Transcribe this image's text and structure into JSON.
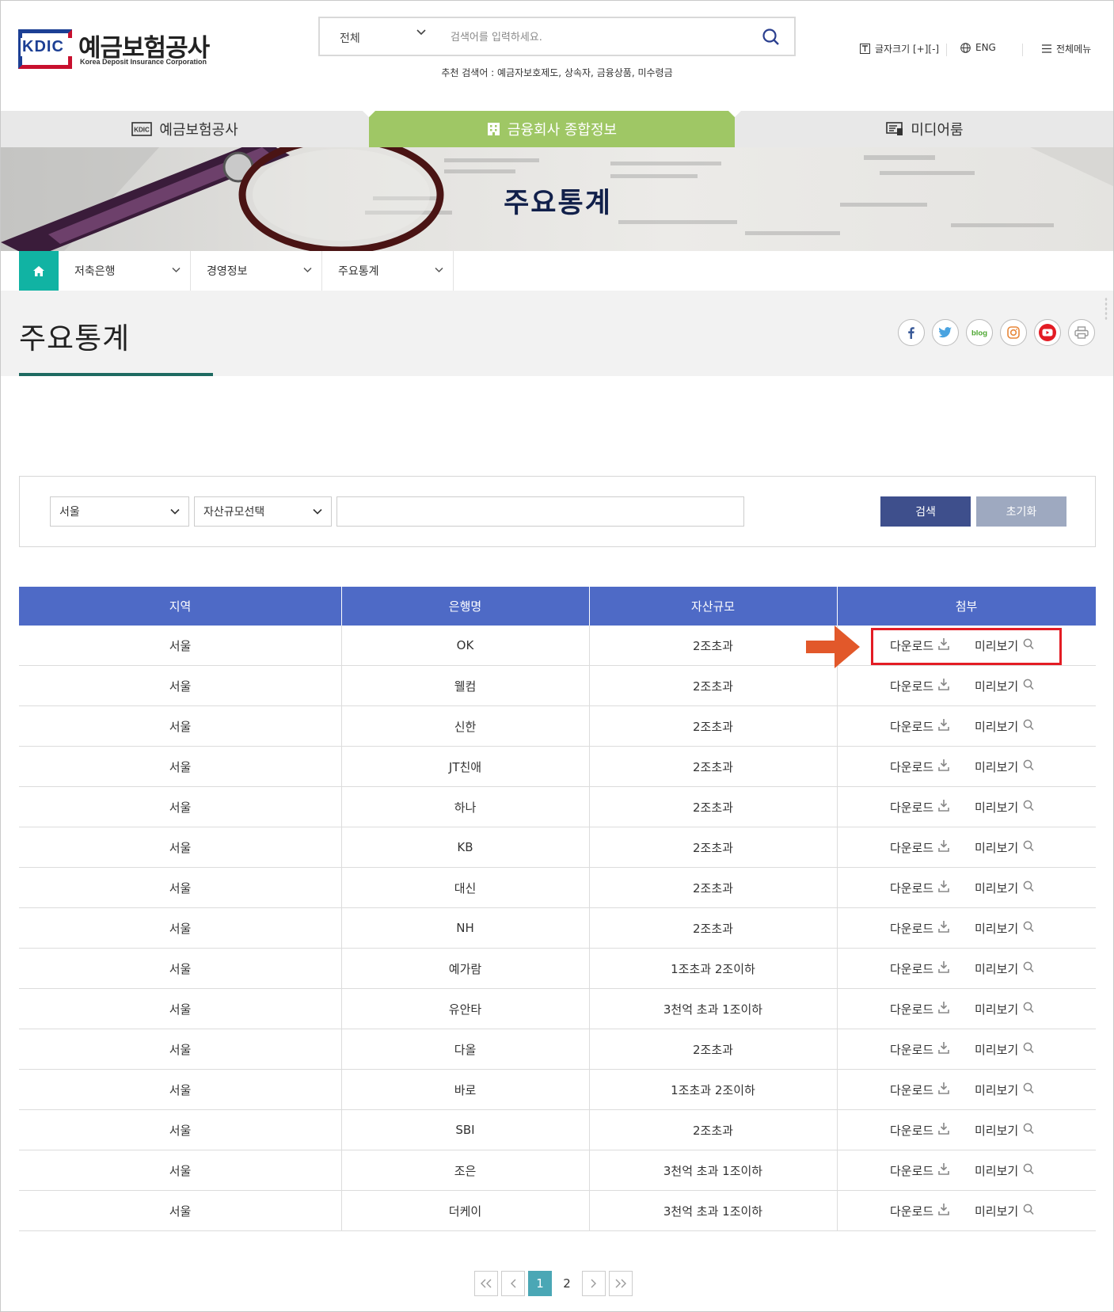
{
  "header": {
    "logo_abbr": "KDIC",
    "logo_name": "예금보험공사",
    "logo_sub": "Korea Deposit Insurance Corporation",
    "search_scope": "전체",
    "search_placeholder": "검색어를 입력하세요.",
    "recommend": "추천 검색어 : 예금자보호제도, 상속자, 금융상품, 미수령금",
    "font_size": "글자크기 [+][-]",
    "lang": "ENG",
    "menu": "전체메뉴"
  },
  "gnb": {
    "tabs": [
      {
        "label": "예금보험공사"
      },
      {
        "label": "금융회사 종합정보"
      },
      {
        "label": "미디어룸"
      }
    ],
    "active_color": "#9fc765"
  },
  "banner": {
    "title": "주요통계"
  },
  "breadcrumb": {
    "items": [
      "저축은행",
      "경영정보",
      "주요통계"
    ]
  },
  "page": {
    "title": "주요통계"
  },
  "filter": {
    "region": "서울",
    "asset": "자산규모선택",
    "keyword": "",
    "search_label": "검색",
    "reset_label": "초기화"
  },
  "table": {
    "headers": [
      "지역",
      "은행명",
      "자산규모",
      "첨부"
    ],
    "download_label": "다운로드",
    "preview_label": "미리보기",
    "rows": [
      {
        "region": "서울",
        "bank": "OK",
        "asset": "2조초과"
      },
      {
        "region": "서울",
        "bank": "웰컴",
        "asset": "2조초과"
      },
      {
        "region": "서울",
        "bank": "신한",
        "asset": "2조초과"
      },
      {
        "region": "서울",
        "bank": "JT친애",
        "asset": "2조초과"
      },
      {
        "region": "서울",
        "bank": "하나",
        "asset": "2조초과"
      },
      {
        "region": "서울",
        "bank": "KB",
        "asset": "2조초과"
      },
      {
        "region": "서울",
        "bank": "대신",
        "asset": "2조초과"
      },
      {
        "region": "서울",
        "bank": "NH",
        "asset": "2조초과"
      },
      {
        "region": "서울",
        "bank": "예가람",
        "asset": "1조초과 2조이하"
      },
      {
        "region": "서울",
        "bank": "유안타",
        "asset": "3천억 초과 1조이하"
      },
      {
        "region": "서울",
        "bank": "다올",
        "asset": "2조초과"
      },
      {
        "region": "서울",
        "bank": "바로",
        "asset": "1조초과 2조이하"
      },
      {
        "region": "서울",
        "bank": "SBI",
        "asset": "2조초과"
      },
      {
        "region": "서울",
        "bank": "조은",
        "asset": "3천억 초과 1조이하"
      },
      {
        "region": "서울",
        "bank": "더케이",
        "asset": "3천억 초과 1조이하"
      }
    ]
  },
  "pagination": {
    "pages": [
      "1",
      "2"
    ],
    "current": "1"
  }
}
